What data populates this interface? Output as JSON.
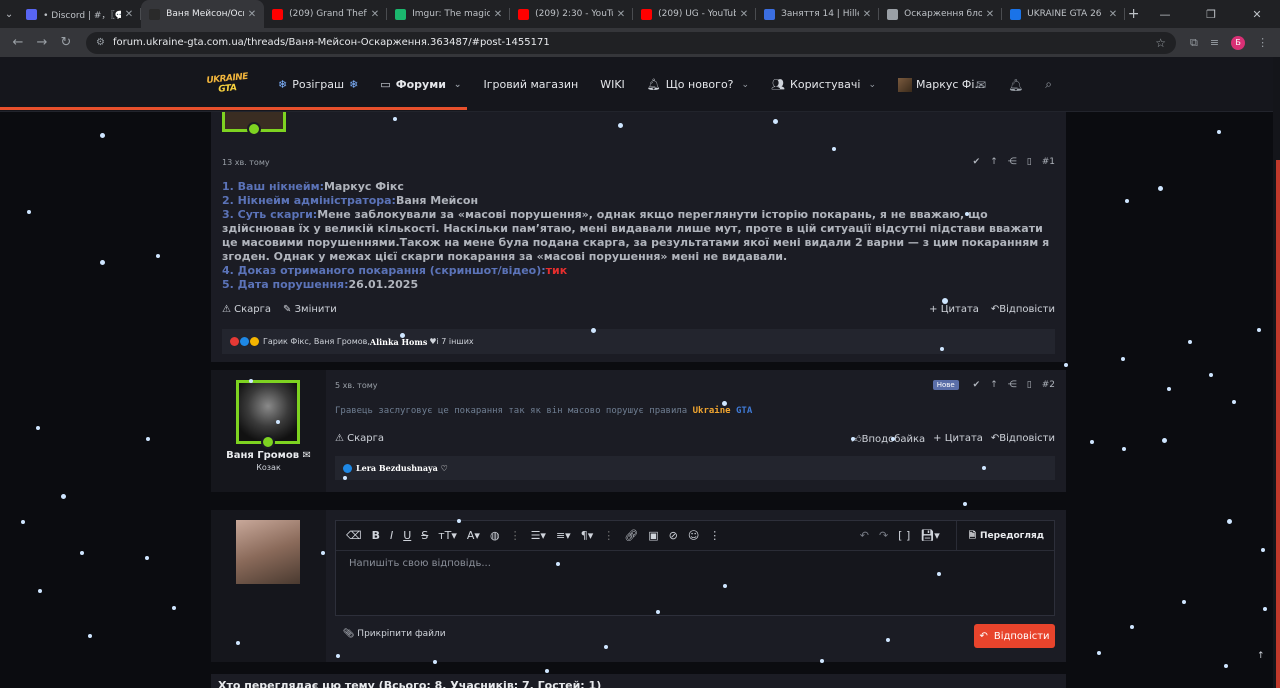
{
  "browser": {
    "tabs": [
      {
        "title": "• Discord | #，〖💬〗 c",
        "color": "#5865f2"
      },
      {
        "title": "Ваня Мейсон/Оскар",
        "color": "#2a2a2a",
        "active": true
      },
      {
        "title": "(209) Grand Theft Au",
        "color": "#ff0000"
      },
      {
        "title": "Imgur: The magic of t",
        "color": "#1bb76e"
      },
      {
        "title": "(209) 2:30 - YouTube",
        "color": "#ff0000"
      },
      {
        "title": "(209) UG - YouTube",
        "color": "#ff0000"
      },
      {
        "title": "Заняття 14 | Hillel LM",
        "color": "#3b6ee0"
      },
      {
        "title": "Оскарження блокув",
        "color": "#9aa0a6"
      },
      {
        "title": "UKRAINE GTA 26 01 2",
        "color": "#1a73e8"
      }
    ],
    "url": "forum.ukraine-gta.com.ua/threads/Ваня-Мейсон-Оскарження.363487/#post-1455171",
    "profile_letter": "Б"
  },
  "site": {
    "logo_line1": "UKRAINE",
    "logo_line2": "GTA",
    "nav": {
      "giveaway": "Розіграш",
      "forums": "Форуми",
      "shop": "Ігровий магазин",
      "wiki": "WIKI",
      "whats_new": "Що нового?",
      "users": "Користувачі",
      "account": "Маркус Фі..."
    }
  },
  "post1": {
    "time": "13 хв. тому",
    "number": "#1",
    "fields": {
      "nick_label": "1. Ваш нікнейм:",
      "nick_value": "Маркус Фікс",
      "admin_label": "2. Нікнейм адміністратора:",
      "admin_value": "Ваня Мейсон",
      "essence_label": "3. Суть скарги:",
      "essence_value": "Мене заблокували за «масові порушення», однак якщо переглянути історію покарань, я не вважаю, що здійснював їх у великій кількості. Наскільки пам’ятаю, мені видавали лише мут, проте в цій ситуації відсутні підстави вважати це масовими порушеннями.Також на мене була подана скарга, за результатами якої мені видали 2 варни — з цим покаранням я згоден. Однак у межах цієї скарги покарання за «масові порушення» мені не видавали.",
      "proof_label": "4. Доказ отриманого покарання (скриншот/відео):",
      "proof_value": "тик",
      "date_label": "5. Дата порушення:",
      "date_value": "26.01.2025"
    },
    "actions": {
      "report": "Скарга",
      "edit": "Змінити",
      "quote": "+ Цитата",
      "reply": "Відповісти"
    },
    "reactions_text": "Гарик Фікс, Ваня Громов, ",
    "reactions_bold": "Alinka Homs",
    "reactions_more": " і 7 інших"
  },
  "post2": {
    "username": "Ваня Громов",
    "user_title": "Козак",
    "time": "5 хв. тому",
    "badge": "Нове",
    "number": "#2",
    "body_prefix": "Гравець заслуговує це покарання так як він масово порушує правила ",
    "body_ua": "Ukraine",
    "body_gta": " GTA",
    "actions": {
      "report": "Скарга",
      "like": "Вподобайка",
      "quote": "+ Цитата",
      "reply": "Відповісти"
    },
    "reactions_text": "Lera Bezdushnaya ♡"
  },
  "reply": {
    "placeholder": "Напишіть свою відповідь...",
    "preview": "Передогляд",
    "attach": "Прикріпити файли",
    "send": "Відповісти"
  },
  "who_viewing": "Хто переглядає цю тему (Всього: 8, Учасників: 7, Гостей: 1)"
}
